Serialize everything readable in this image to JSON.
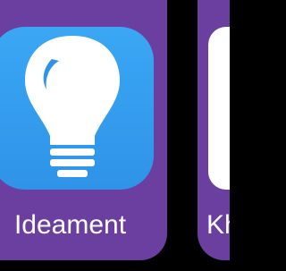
{
  "colors": {
    "background": "#000000",
    "tile": "#6b3fa0",
    "icon_bg": "#2f93e8",
    "label": "#ffffff"
  },
  "apps": [
    {
      "name": "Ideament",
      "icon": "lightbulb-icon"
    },
    {
      "name": "Kh",
      "icon": "blank-icon"
    }
  ]
}
